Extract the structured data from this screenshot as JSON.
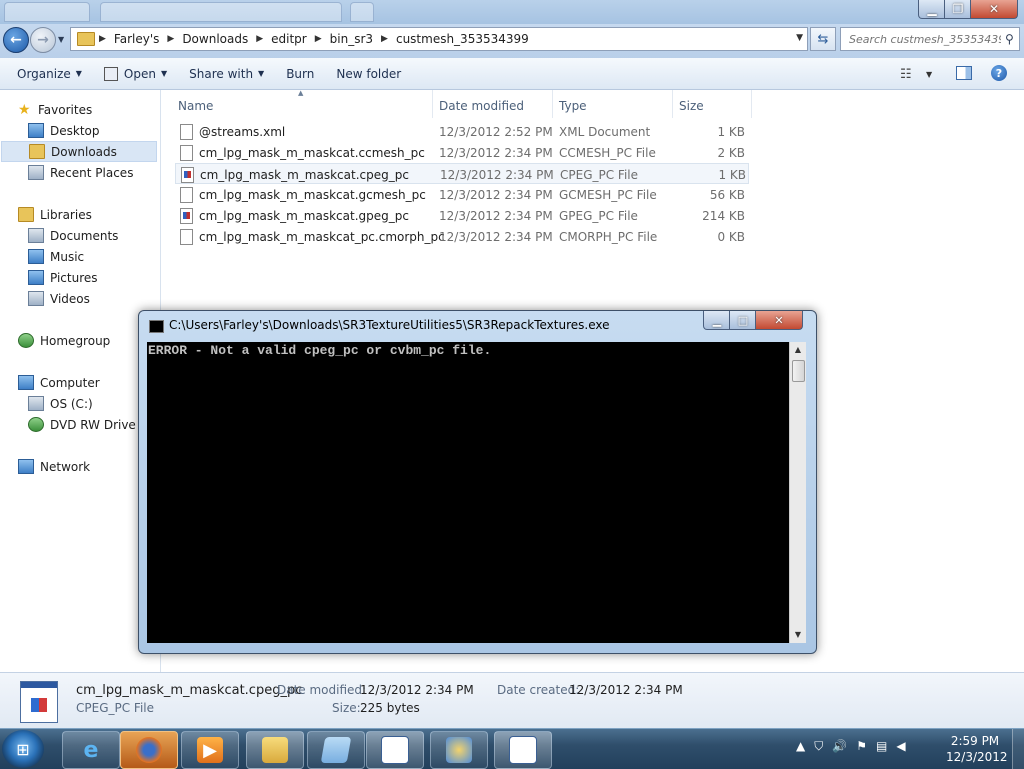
{
  "explorer": {
    "address": {
      "crumbs": [
        "Farley's",
        "Downloads",
        "editpr",
        "bin_sr3",
        "custmesh_353534399"
      ]
    },
    "search": {
      "placeholder": "Search custmesh_353534399"
    },
    "toolbar": {
      "organize": "Organize",
      "open": "Open",
      "share_with": "Share with",
      "burn": "Burn",
      "new_folder": "New folder"
    },
    "nav": {
      "favorites": "Favorites",
      "desktop": "Desktop",
      "downloads": "Downloads",
      "recent_places": "Recent Places",
      "libraries": "Libraries",
      "documents": "Documents",
      "music": "Music",
      "pictures": "Pictures",
      "videos": "Videos",
      "homegroup": "Homegroup",
      "computer": "Computer",
      "os_c": "OS (C:)",
      "dvd": "DVD RW Drive (D",
      "network": "Network"
    },
    "columns": {
      "name": "Name",
      "date_modified": "Date modified",
      "type": "Type",
      "size": "Size"
    },
    "files": [
      {
        "name": "@streams.xml",
        "date": "12/3/2012 2:52 PM",
        "type": "XML Document",
        "size": "1 KB"
      },
      {
        "name": "cm_lpg_mask_m_maskcat.ccmesh_pc",
        "date": "12/3/2012 2:34 PM",
        "type": "CCMESH_PC File",
        "size": "2 KB"
      },
      {
        "name": "cm_lpg_mask_m_maskcat.cpeg_pc",
        "date": "12/3/2012 2:34 PM",
        "type": "CPEG_PC File",
        "size": "1 KB"
      },
      {
        "name": "cm_lpg_mask_m_maskcat.gcmesh_pc",
        "date": "12/3/2012 2:34 PM",
        "type": "GCMESH_PC File",
        "size": "56 KB"
      },
      {
        "name": "cm_lpg_mask_m_maskcat.gpeg_pc",
        "date": "12/3/2012 2:34 PM",
        "type": "GPEG_PC File",
        "size": "214 KB"
      },
      {
        "name": "cm_lpg_mask_m_maskcat_pc.cmorph_pc",
        "date": "12/3/2012 2:34 PM",
        "type": "CMORPH_PC File",
        "size": "0 KB"
      }
    ],
    "details": {
      "filename": "cm_lpg_mask_m_maskcat.cpeg_pc",
      "filetype": "CPEG_PC File",
      "date_modified_label": "Date modified:",
      "date_modified": "12/3/2012 2:34 PM",
      "date_created_label": "Date created:",
      "date_created": "12/3/2012 2:34 PM",
      "size_label": "Size:",
      "size": "225 bytes"
    }
  },
  "console": {
    "title": "C:\\Users\\Farley's\\Downloads\\SR3TextureUtilities5\\SR3RepackTextures.exe",
    "output": "ERROR - Not a valid cpeg_pc or cvbm_pc file."
  },
  "taskbar": {
    "time": "2:59 PM",
    "date": "12/3/2012",
    "apps": [
      "internet-explorer",
      "firefox",
      "media-player",
      "windows-explorer",
      "notepad",
      "console-app",
      "paint",
      "console-app"
    ]
  },
  "colors": {
    "accent": "#2c58a0",
    "selection": "#d9e6f5",
    "taskbar": "#2f4e6b",
    "console_bg": "#000000",
    "console_text": "#c0c0c0"
  }
}
